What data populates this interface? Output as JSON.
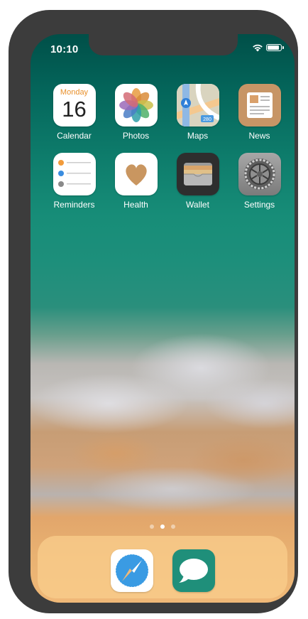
{
  "status_bar": {
    "time": "10:10"
  },
  "home_screen": {
    "apps": [
      {
        "label": "Calendar",
        "icon": "calendar-icon",
        "weekday": "Monday",
        "date": "16"
      },
      {
        "label": "Photos",
        "icon": "photos-icon"
      },
      {
        "label": "Maps",
        "icon": "maps-icon",
        "badge_text": "280"
      },
      {
        "label": "News",
        "icon": "news-icon"
      },
      {
        "label": "Reminders",
        "icon": "reminders-icon"
      },
      {
        "label": "Health",
        "icon": "health-icon"
      },
      {
        "label": "Wallet",
        "icon": "wallet-icon"
      },
      {
        "label": "Settings",
        "icon": "settings-icon"
      }
    ],
    "page_count": 3,
    "active_page": 2
  },
  "dock": {
    "apps": [
      {
        "icon": "safari-icon"
      },
      {
        "icon": "messages-icon"
      }
    ]
  },
  "colors": {
    "phone_frame": "#3c3c3c",
    "calendar_accent": "#e8902c",
    "news_bg": "#c79566",
    "messages_bg": "#1f8f7a",
    "safari_blue": "#3a9be3"
  }
}
